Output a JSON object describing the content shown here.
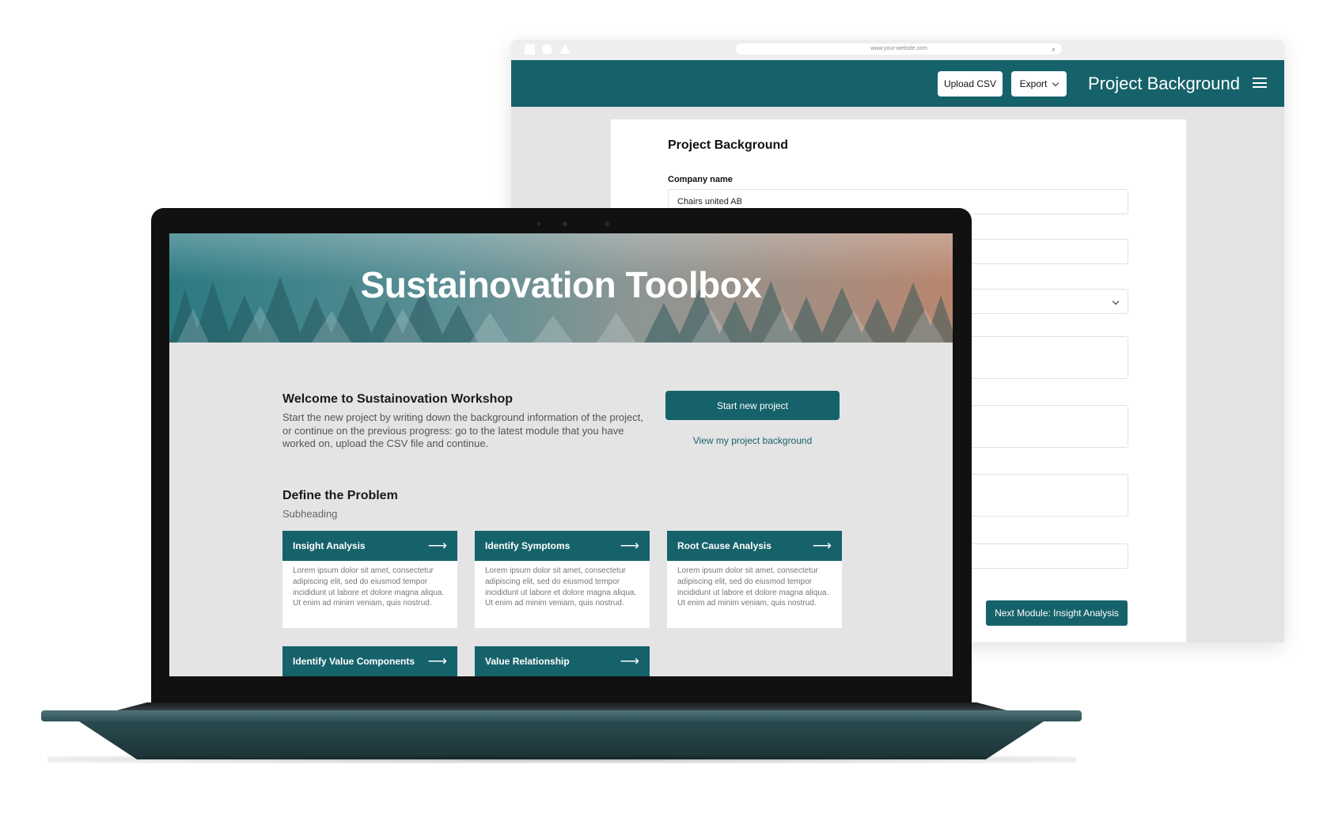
{
  "browser": {
    "url": "www.your-website.com",
    "toolbar": {
      "upload_label": "Upload CSV",
      "export_label": "Export",
      "title": "Project Background"
    },
    "form": {
      "title": "Project Background",
      "company_label": "Company name",
      "company_value": "Chairs united AB",
      "next_button": "Next Module: Insight Analysis"
    }
  },
  "laptop": {
    "hero_title": "Sustainovation Toolbox",
    "welcome": {
      "title": "Welcome to  Sustainovation Workshop",
      "text": "Start the new project by writing down the background information of the project, or continue on the previous progress: go to the latest module that you have worked on, upload the CSV file and continue.",
      "start_button": "Start new project",
      "view_link": "View my project background"
    },
    "section": {
      "title": "Define the Problem",
      "subheading": "Subheading"
    },
    "modules": [
      {
        "title": "Insight Analysis",
        "body": "Lorem ipsum dolor sit amet, consectetur adipiscing elit, sed do eiusmod tempor incididunt ut labore et dolore magna aliqua. Ut enim ad minim veniam, quis nostrud."
      },
      {
        "title": "Identify Symptoms",
        "body": "Lorem ipsum dolor sit amet, consectetur adipiscing elit, sed do eiusmod tempor incididunt ut labore et dolore magna aliqua. Ut enim ad minim veniam, quis nostrud."
      },
      {
        "title": "Root Cause Analysis",
        "body": "Lorem ipsum dolor sit amet, consectetur adipiscing elit, sed do eiusmod tempor incididunt ut labore et dolore magna aliqua. Ut enim ad minim veniam, quis nostrud."
      },
      {
        "title": "Identify Value Components"
      },
      {
        "title": "Value Relationship"
      }
    ],
    "module_arrow": "⟶"
  },
  "colors": {
    "brand_teal": "#16626a",
    "page_grey": "#e4e4e4"
  }
}
